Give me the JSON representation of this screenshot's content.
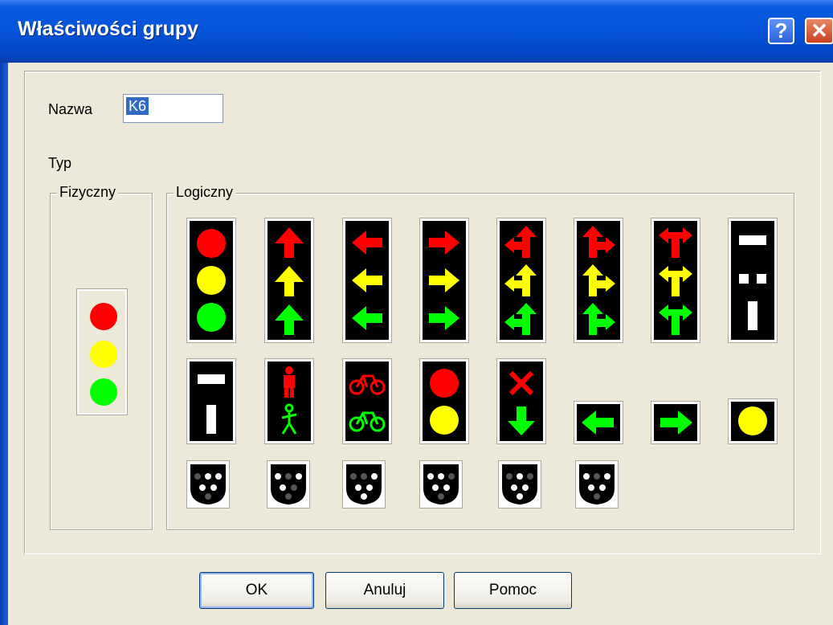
{
  "window": {
    "title": "Właściwości grupy",
    "help_label": "?",
    "close_label": "✕"
  },
  "form": {
    "name_label": "Nazwa",
    "name_value": "K6",
    "type_label": "Typ",
    "physical_group_label": "Fizyczny",
    "logical_group_label": "Logiczny"
  },
  "buttons": {
    "ok": "OK",
    "cancel": "Anuluj",
    "help": "Pomoc"
  },
  "colors": {
    "red": "#ff0000",
    "yellow": "#ffff00",
    "green": "#00ff00",
    "title_bar": "#0553d8",
    "dialog_bg": "#ece9d8"
  },
  "signal_icons": {
    "physical": "traffic-light-3-circles",
    "logical_row1": [
      "traffic-light-3-circles",
      "arrow-up-3",
      "arrow-left-3",
      "arrow-right-3",
      "arrow-left-up-3",
      "arrow-up-right-3",
      "arrow-left-right-3",
      "tram-signal"
    ],
    "logical_row2": [
      "tram-signal-2",
      "pedestrian-signal",
      "bicycle-signal",
      "red-yellow-signal",
      "cross-down-arrow-signal",
      "green-left-arrow",
      "green-right-arrow",
      "yellow-circle"
    ],
    "logical_row3": [
      "shield-signal-1",
      "shield-signal-2",
      "shield-signal-3",
      "shield-signal-4",
      "shield-signal-5",
      "shield-signal-6"
    ]
  }
}
